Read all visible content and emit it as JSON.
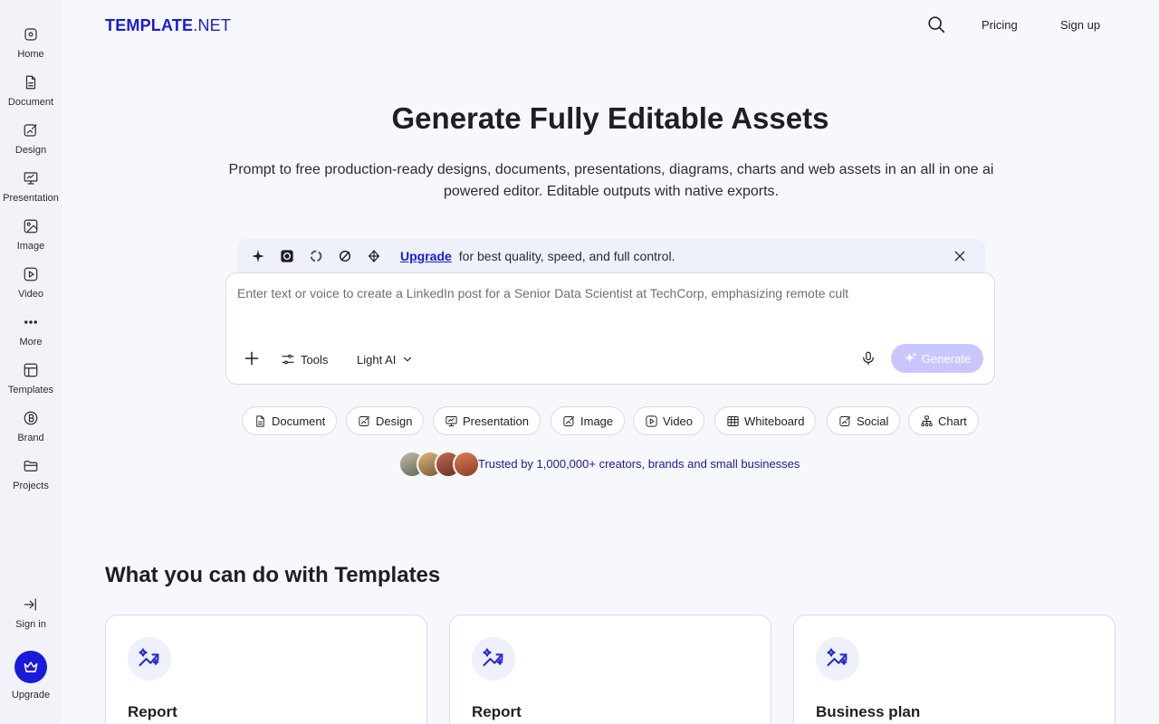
{
  "sidebar": {
    "items": [
      {
        "label": "Home",
        "icon": "home-icon"
      },
      {
        "label": "Document",
        "icon": "document-icon"
      },
      {
        "label": "Design",
        "icon": "design-icon"
      },
      {
        "label": "Presentation",
        "icon": "presentation-icon"
      },
      {
        "label": "Image",
        "icon": "image-icon"
      },
      {
        "label": "Video",
        "icon": "video-icon"
      },
      {
        "label": "More",
        "icon": "more-icon"
      },
      {
        "label": "Templates",
        "icon": "templates-icon"
      },
      {
        "label": "Brand",
        "icon": "brand-icon"
      },
      {
        "label": "Projects",
        "icon": "folder-icon"
      }
    ],
    "sign_in": "Sign in",
    "upgrade": "Upgrade"
  },
  "header": {
    "logo_bold": "TEMPLATE",
    "logo_rest": ".NET",
    "pricing": "Pricing",
    "sign_up": "Sign up"
  },
  "hero": {
    "title": "Generate Fully Editable Assets",
    "subtitle": "Prompt to free production-ready designs, documents, presentations, diagrams, charts and web assets in an all in one ai powered editor. Editable outputs with native exports."
  },
  "strip": {
    "upgrade_link": "Upgrade",
    "text": "for best quality, speed, and full control."
  },
  "prompt": {
    "placeholder": "Enter text or voice to create a LinkedIn post for a Senior Data Scientist at TechCorp, emphasizing remote cult",
    "tools_label": "Tools",
    "model_label": "Light AI",
    "generate_label": "Generate"
  },
  "chips": [
    {
      "label": "Document"
    },
    {
      "label": "Design"
    },
    {
      "label": "Presentation"
    },
    {
      "label": "Image"
    },
    {
      "label": "Video"
    },
    {
      "label": "Whiteboard"
    },
    {
      "label": "Social"
    },
    {
      "label": "Chart"
    }
  ],
  "trust": {
    "text": "Trusted by 1,000,000+ creators, brands and small businesses"
  },
  "section": {
    "title": "What you can do with Templates",
    "cards": [
      {
        "title": "Report"
      },
      {
        "title": "Report"
      },
      {
        "title": "Business plan"
      }
    ]
  },
  "colors": {
    "brand": "#1a1adb",
    "generate_disabled": "#c9c6ff",
    "page_bg": "#f7f8fc"
  }
}
